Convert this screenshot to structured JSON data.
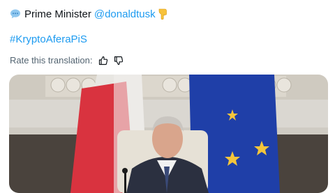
{
  "tweet": {
    "author_label": "Prime Minister",
    "mention": "@donaldtusk",
    "hashtag": "#KryptoAferaPiS"
  },
  "translation": {
    "rate_label": "Rate this translation:"
  },
  "icons": {
    "lead": "speech-bubble-icon",
    "hand": "pointing-down-hand-icon",
    "thumbs_up": "thumbs-up-icon",
    "thumbs_down": "thumbs-down-icon"
  },
  "colors": {
    "link": "#1d9bf0",
    "muted": "#536471",
    "eu_blue": "#1f3fa8",
    "polish_red": "#d9333f"
  }
}
